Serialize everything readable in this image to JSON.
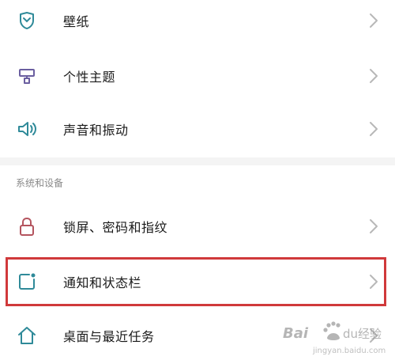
{
  "settings": {
    "wallpaper": {
      "label": "壁纸",
      "icon": "wallpaper-icon"
    },
    "theme": {
      "label": "个性主题",
      "icon": "paint-roller-icon"
    },
    "sound": {
      "label": "声音和振动",
      "icon": "speaker-icon"
    },
    "system_section": {
      "title": "系统和设备"
    },
    "lock_screen": {
      "label": "锁屏、密码和指纹",
      "icon": "lock-icon"
    },
    "notifications": {
      "label": "通知和状态栏",
      "icon": "notification-icon"
    },
    "home_screen": {
      "label": "桌面与最近任务",
      "icon": "home-icon"
    }
  },
  "watermark": {
    "brand": "Baidu经验",
    "url": "jingyan.baidu.com"
  },
  "colors": {
    "icon_teal": "#2f8a99",
    "icon_purple": "#6b5fa0",
    "icon_red": "#b4545e",
    "highlight": "#d0393b",
    "chevron": "#b8b8b8",
    "section_bg": "#f4f4f4"
  }
}
